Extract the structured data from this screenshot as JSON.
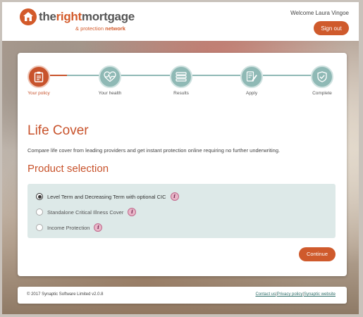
{
  "header": {
    "brand_the": "the",
    "brand_right": "right",
    "brand_mortgage": "mortgage",
    "tagline_prefix": "& protection",
    "tagline_network": "network",
    "welcome": "Welcome Laura Vingoe",
    "signout_label": "Sign out"
  },
  "steps": [
    {
      "label": "Your policy",
      "icon": "clipboard-icon",
      "state": "active"
    },
    {
      "label": "Your health",
      "icon": "heart-pulse-icon",
      "state": "pending"
    },
    {
      "label": "Results",
      "icon": "list-icon",
      "state": "pending"
    },
    {
      "label": "Apply",
      "icon": "form-pen-icon",
      "state": "pending"
    },
    {
      "label": "Complete",
      "icon": "shield-check-icon",
      "state": "pending"
    }
  ],
  "main": {
    "title": "Life Cover",
    "description": "Compare life cover from leading providers and get instant protection online requiring no further underwriting.",
    "section_title": "Product selection",
    "options": [
      {
        "label": "Level Term and Decreasing Term with optional CIC",
        "selected": true
      },
      {
        "label": "Standalone Critical Illness Cover",
        "selected": false
      },
      {
        "label": "Income Protection",
        "selected": false
      }
    ],
    "info_glyph": "i",
    "continue_label": "Continue"
  },
  "footer": {
    "copyright": "© 2017 Synaptic Software Limited v2.0.8",
    "links": [
      "Contact us",
      "Privacy policy",
      "Synaptic website"
    ],
    "separator": "|"
  },
  "colors": {
    "accent": "#cf5a2c",
    "step_pending": "#8fb9b5",
    "option_panel": "#dde9e8",
    "info_badge": "#e9b6c8"
  }
}
